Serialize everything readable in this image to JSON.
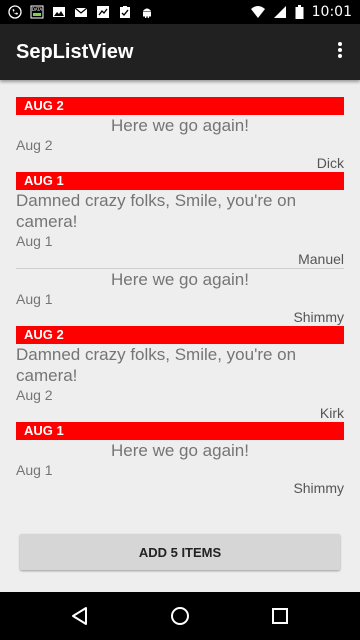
{
  "status_bar": {
    "time": "10:01",
    "left_icons": [
      "phone-icon",
      "sim-data-icon",
      "image-icon",
      "gmail-icon",
      "photo-icon",
      "clipboard-check-icon",
      "android-icon"
    ],
    "right_icons": [
      "wifi-icon",
      "signal-icon",
      "battery-icon"
    ],
    "sim_label": "DATA"
  },
  "app_bar": {
    "title": "SepListView",
    "menu_icon": "overflow-menu-icon"
  },
  "list": {
    "sections": [
      {
        "header": "AUG 2",
        "items": [
          {
            "message": "Here we go again!",
            "centered": true,
            "date": "Aug 2",
            "author": "Dick"
          }
        ]
      },
      {
        "header": "AUG 1",
        "items": [
          {
            "message": "Damned crazy folks, Smile, you're on camera!",
            "centered": false,
            "date": "Aug 1",
            "author": "Manuel"
          },
          {
            "message": "Here we go again!",
            "centered": true,
            "date": "Aug 1",
            "author": "Shimmy"
          }
        ]
      },
      {
        "header": "AUG 2",
        "items": [
          {
            "message": "Damned crazy folks, Smile, you're on camera!",
            "centered": false,
            "date": "Aug 2",
            "author": "Kirk"
          }
        ]
      },
      {
        "header": "AUG 1",
        "items": [
          {
            "message": "Here we go again!",
            "centered": true,
            "date": "Aug 1",
            "author": "Shimmy"
          }
        ]
      }
    ]
  },
  "add_button": {
    "label": "ADD 5 ITEMS"
  },
  "nav_bar": {
    "buttons": [
      "back-icon",
      "home-icon",
      "recents-icon"
    ]
  },
  "colors": {
    "header_red": "#ff0000",
    "app_bar": "#212121",
    "background": "#eeeeee"
  }
}
